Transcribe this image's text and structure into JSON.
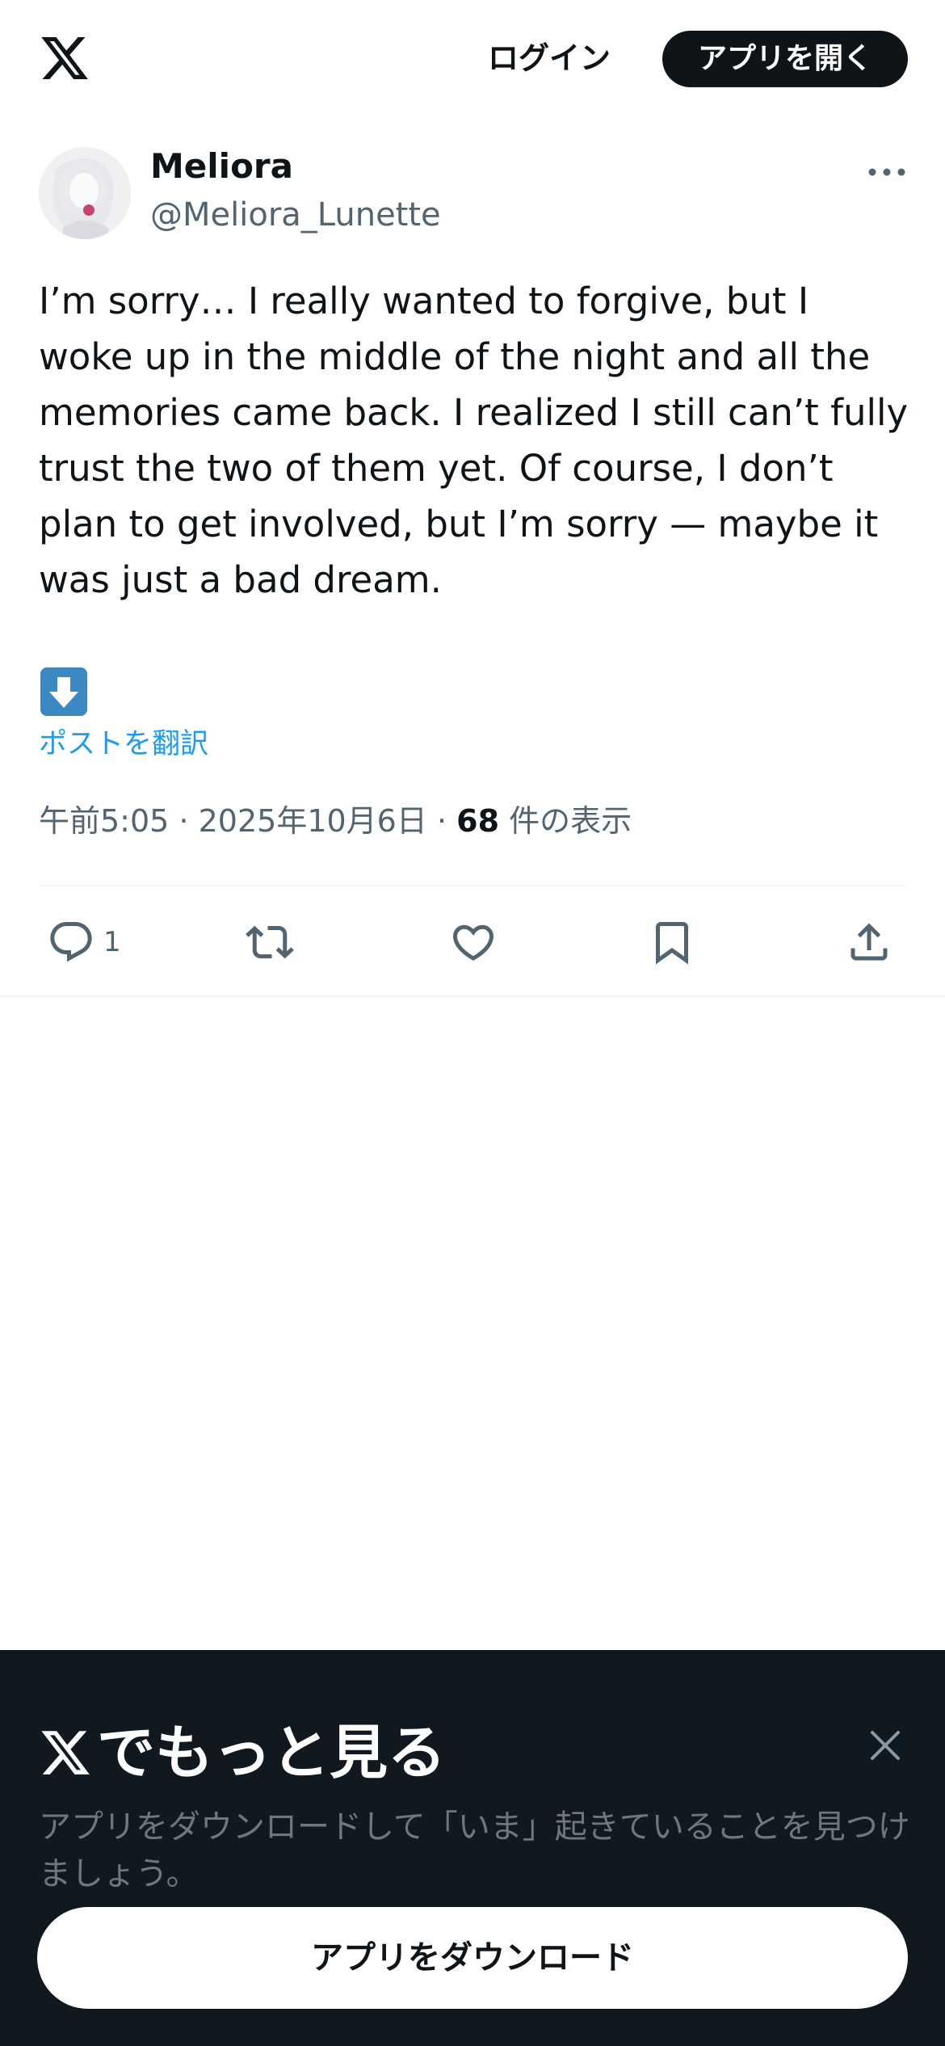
{
  "header": {
    "logo_icon": "x-logo-icon",
    "login_label": "ログイン",
    "open_app_label": "アプリを開く"
  },
  "post": {
    "author_name": "Meliora",
    "author_handle": "@Meliora_Lunette",
    "text": "I’m sorry… I really wanted to forgive, but I woke up in the middle of the night and all the memories came back. I realized I still can’t fully trust the two of them yet. Of course, I don’t plan to get involved, but I’m sorry — maybe it was just a bad dream.",
    "emoji": "down-arrow-emoji",
    "translate_label": "ポストを翻訳",
    "time": "午前5:05",
    "date": "2025年10月6日",
    "separator": "·",
    "views_count": "68",
    "views_label": "件の表示"
  },
  "actions": {
    "reply_count": "1",
    "icons": [
      "reply-icon",
      "retweet-icon",
      "like-icon",
      "bookmark-icon",
      "share-icon"
    ]
  },
  "promo": {
    "title": "でもっと見る",
    "description": "アプリをダウンロードして「いま」起きていることを見つけましょう。",
    "download_label": "アプリをダウンロード"
  },
  "colors": {
    "text_primary": "#0f1419",
    "text_secondary": "#536471",
    "link": "#1d9bf0",
    "promo_bg": "#101820"
  }
}
